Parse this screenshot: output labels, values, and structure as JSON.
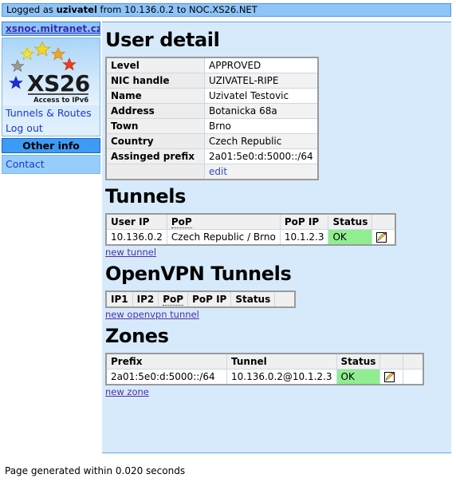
{
  "topbar": {
    "prefix": "Logged as ",
    "user": "uzivatel",
    "middle": " from 10.136.0.2 to NOC.XS26.NET"
  },
  "sidebar": {
    "site_link": "xsnoc.mitranet.cz",
    "logo": {
      "name": "XS26",
      "tagline": "Access to IPv6"
    },
    "links": [
      {
        "label": "Tunnels & Routes"
      },
      {
        "label": "Log out"
      }
    ],
    "other_info_header": "Other info",
    "other_links": [
      {
        "label": "Contact"
      }
    ]
  },
  "main": {
    "user_detail": {
      "title": "User detail",
      "rows": [
        {
          "key": "Level",
          "value": "APPROVED"
        },
        {
          "key": "NIC handle",
          "value": "UZIVATEL-RIPE"
        },
        {
          "key": "Name",
          "value": "Uzivatel Testovic"
        },
        {
          "key": "Address",
          "value": "Botanicka 68a"
        },
        {
          "key": "Town",
          "value": "Brno"
        },
        {
          "key": "Country",
          "value": "Czech Republic"
        },
        {
          "key": "Assinged prefix",
          "value": "2a01:5e0:d:5000::/64"
        }
      ],
      "edit_link": "edit"
    },
    "tunnels": {
      "title": "Tunnels",
      "headers": [
        "User IP",
        "PoP",
        "PoP IP",
        "Status",
        ""
      ],
      "rows": [
        {
          "user_ip": "10.136.0.2",
          "pop": "Czech Republic / Brno",
          "pop_ip": "10.1.2.3",
          "status": "OK"
        }
      ],
      "new_link": "new tunnel"
    },
    "openvpn": {
      "title": "OpenVPN Tunnels",
      "headers": [
        "IP1",
        "IP2",
        "PoP",
        "PoP IP",
        "Status",
        ""
      ],
      "rows": [],
      "new_link": "new openvpn tunnel"
    },
    "zones": {
      "title": "Zones",
      "headers": [
        "Prefix",
        "Tunnel",
        "Status",
        "",
        ""
      ],
      "rows": [
        {
          "prefix": "2a01:5e0:d:5000::/64",
          "tunnel": "10.136.0.2@10.1.2.3",
          "status": "OK"
        }
      ],
      "new_link": "new zone"
    }
  },
  "footer": {
    "text": "Page generated within 0.020 seconds"
  },
  "colors": {
    "topbar_bg": "#8ec4f7",
    "content_bg": "#d7eafc",
    "status_ok_bg": "#90ee90",
    "section_head_bg": "#3d9bf5",
    "link": "#1b39c9"
  }
}
